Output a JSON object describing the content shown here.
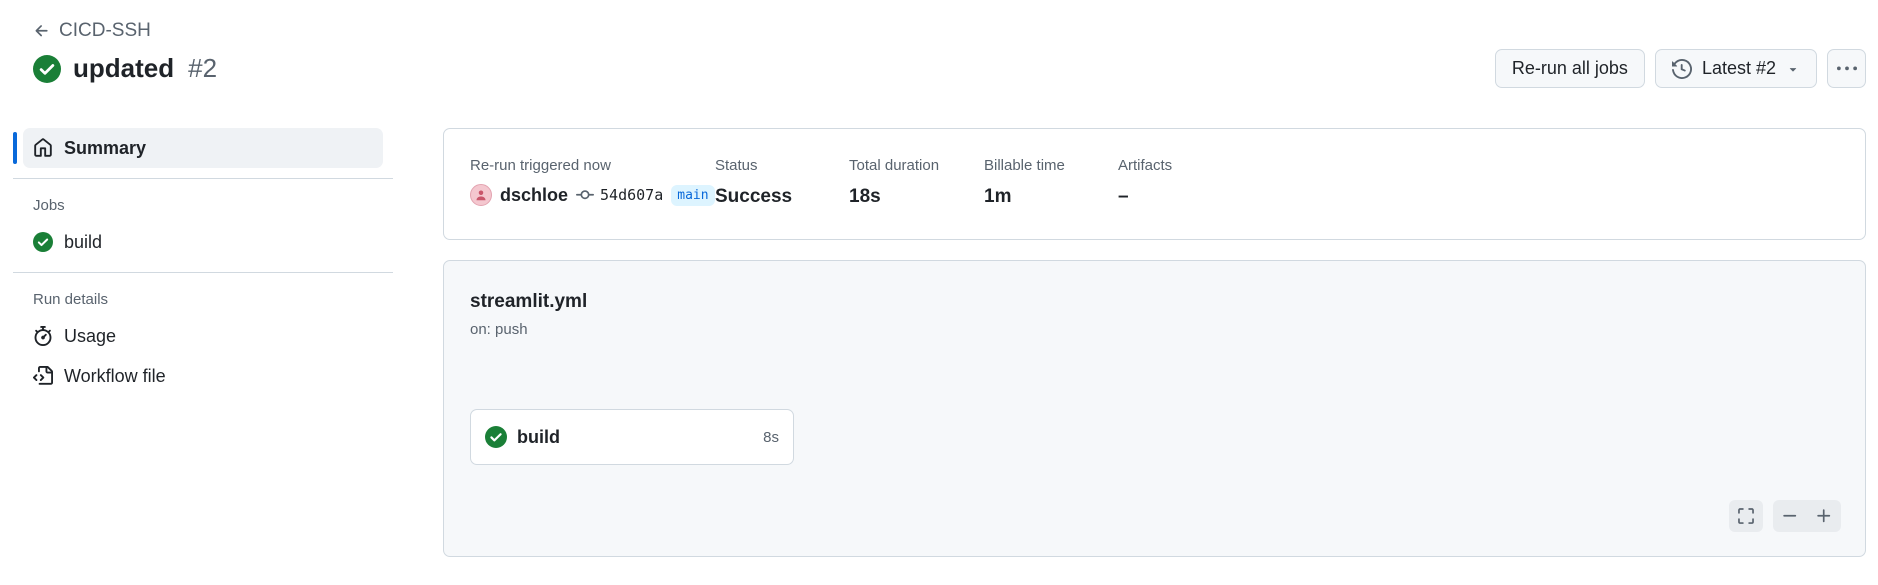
{
  "header": {
    "back_label": "CICD-SSH",
    "run_title": "updated",
    "run_number": "#2",
    "rerun_label": "Re-run all jobs",
    "attempt_label": "Latest #2"
  },
  "sidebar": {
    "summary_label": "Summary",
    "jobs_heading": "Jobs",
    "jobs": [
      {
        "label": "build"
      }
    ],
    "run_details_heading": "Run details",
    "usage_label": "Usage",
    "workflow_file_label": "Workflow file"
  },
  "summary": {
    "trigger_label": "Re-run triggered now",
    "actor": "dschloe",
    "commit_sha": "54d607a",
    "branch": "main",
    "status_label": "Status",
    "status_value": "Success",
    "duration_label": "Total duration",
    "duration_value": "18s",
    "billable_label": "Billable time",
    "billable_value": "1m",
    "artifacts_label": "Artifacts",
    "artifacts_value": "–"
  },
  "workflow": {
    "name": "streamlit.yml",
    "trigger": "on: push",
    "jobs": [
      {
        "name": "build",
        "duration": "8s"
      }
    ]
  },
  "colors": {
    "success": "#1a7f37",
    "accent": "#0969da"
  }
}
